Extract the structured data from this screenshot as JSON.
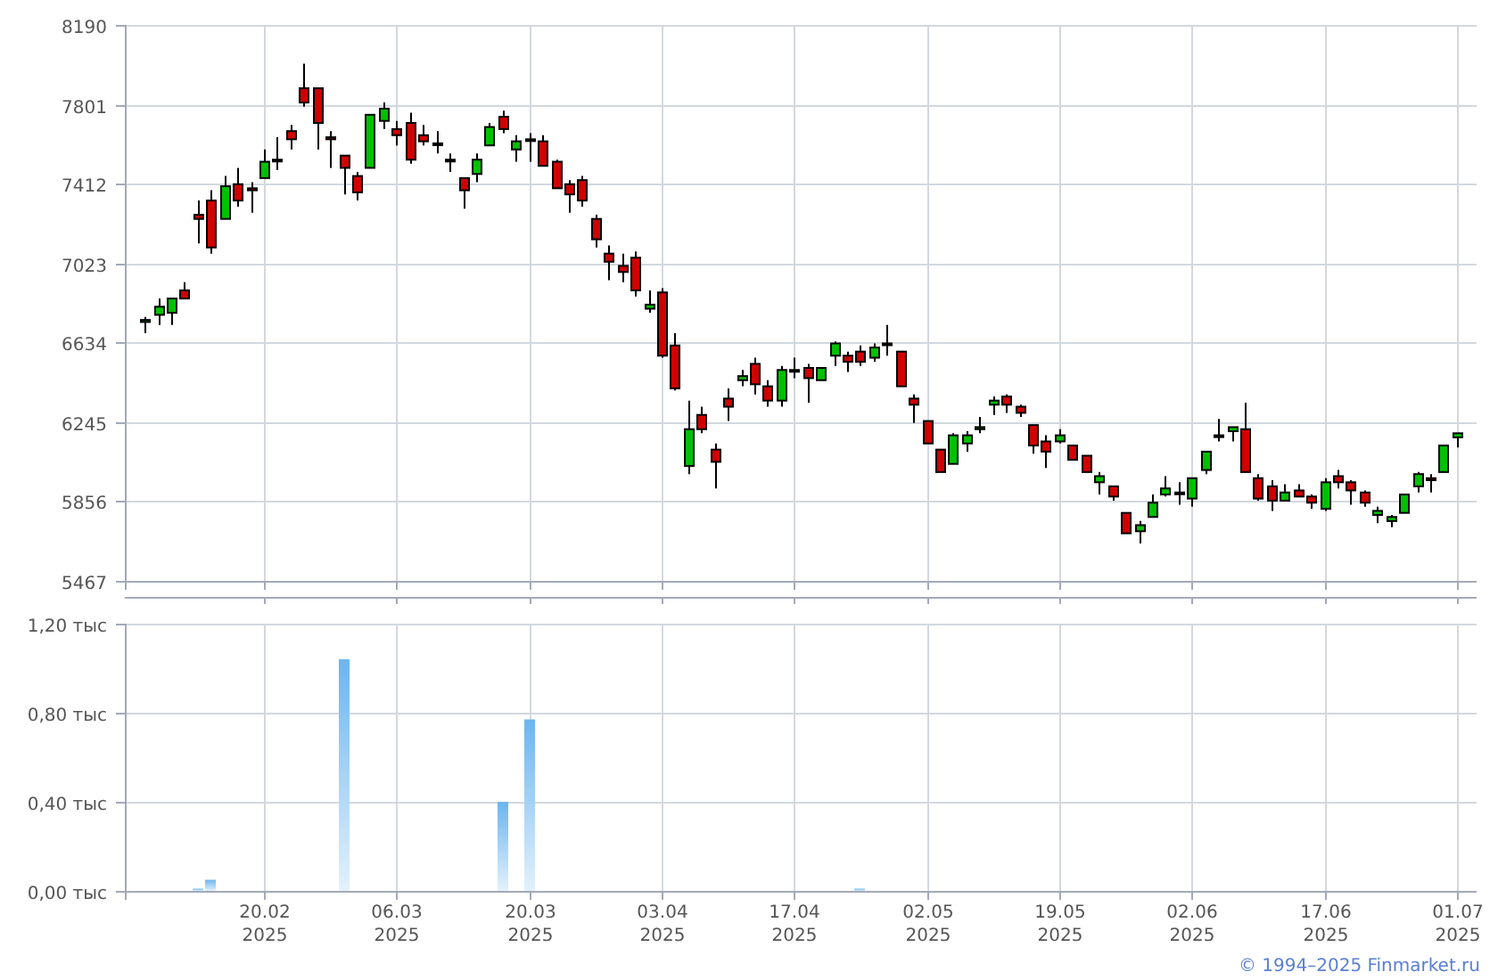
{
  "price_chart": {
    "chart_data": {
      "type": "candlestick",
      "grid": true,
      "ylim": [
        5467,
        8190
      ],
      "yticks": [
        8190,
        7801,
        7412,
        7023,
        6634,
        6245,
        5856,
        5467
      ],
      "categories": [
        null,
        null,
        null,
        null,
        null,
        null,
        null,
        null,
        null,
        null,
        null,
        null,
        null,
        null,
        null,
        null,
        null,
        null,
        null,
        null,
        null,
        null,
        null,
        null,
        null,
        null,
        null,
        null,
        null,
        null,
        null,
        null,
        null,
        null,
        null,
        null,
        null,
        null,
        null,
        null,
        null,
        null,
        null,
        null,
        null,
        null,
        null,
        null,
        null,
        null,
        null,
        null,
        null,
        null,
        null,
        null,
        null,
        null,
        null,
        null,
        null,
        null,
        null,
        null,
        null,
        null,
        null,
        null,
        null,
        null,
        null,
        null,
        null,
        null,
        null,
        null,
        null,
        null,
        null,
        null,
        null,
        null,
        null,
        null,
        null,
        null,
        null,
        null,
        null,
        null,
        null,
        null,
        null,
        null,
        null,
        null,
        null,
        null,
        null,
        null,
        null,
        null
      ],
      "ohlc": [
        null,
        [
          6735,
          6760,
          6680,
          6745
        ],
        [
          6770,
          6850,
          6720,
          6810
        ],
        [
          6780,
          6850,
          6720,
          6850
        ],
        [
          6890,
          6930,
          6850,
          6850
        ],
        [
          7260,
          7330,
          7120,
          7240
        ],
        [
          7330,
          7380,
          7070,
          7100
        ],
        [
          7240,
          7450,
          7240,
          7400
        ],
        [
          7410,
          7490,
          7300,
          7330
        ],
        [
          7390,
          7420,
          7270,
          7380
        ],
        [
          7440,
          7580,
          7440,
          7520
        ],
        [
          7530,
          7640,
          7480,
          7530
        ],
        [
          7670,
          7700,
          7580,
          7630
        ],
        [
          7880,
          8000,
          7790,
          7810
        ],
        [
          7880,
          7880,
          7580,
          7710
        ],
        [
          7640,
          7670,
          7490,
          7630
        ],
        [
          7550,
          7550,
          7360,
          7490
        ],
        [
          7450,
          7470,
          7330,
          7370
        ],
        [
          7490,
          7750,
          7490,
          7750
        ],
        [
          7720,
          7810,
          7680,
          7780
        ],
        [
          7680,
          7720,
          7600,
          7650
        ],
        [
          7710,
          7760,
          7510,
          7530
        ],
        [
          7650,
          7700,
          7600,
          7620
        ],
        [
          7610,
          7670,
          7560,
          7610
        ],
        [
          7530,
          7560,
          7470,
          7530
        ],
        [
          7440,
          7440,
          7290,
          7380
        ],
        [
          7460,
          7560,
          7420,
          7530
        ],
        [
          7600,
          7710,
          7600,
          7690
        ],
        [
          7740,
          7770,
          7660,
          7680
        ],
        [
          7580,
          7650,
          7520,
          7620
        ],
        [
          7630,
          7660,
          7520,
          7630
        ],
        [
          7620,
          7650,
          7500,
          7500
        ],
        [
          7520,
          7530,
          7390,
          7390
        ],
        [
          7410,
          7430,
          7270,
          7360
        ],
        [
          7430,
          7450,
          7300,
          7330
        ],
        [
          7240,
          7260,
          7100,
          7140
        ],
        [
          7070,
          7110,
          6940,
          7030
        ],
        [
          7010,
          7070,
          6930,
          6980
        ],
        [
          7050,
          7080,
          6860,
          6890
        ],
        [
          6800,
          6890,
          6780,
          6820
        ],
        [
          6880,
          6900,
          6560,
          6570
        ],
        [
          6620,
          6680,
          6400,
          6410
        ],
        [
          6030,
          6350,
          5990,
          6210
        ],
        [
          6280,
          6320,
          6190,
          6210
        ],
        [
          6110,
          6140,
          5920,
          6050
        ],
        [
          6360,
          6410,
          6250,
          6320
        ],
        [
          6450,
          6500,
          6420,
          6470
        ],
        [
          6530,
          6560,
          6380,
          6430
        ],
        [
          6420,
          6450,
          6320,
          6350
        ],
        [
          6350,
          6520,
          6320,
          6500
        ],
        [
          6500,
          6560,
          6460,
          6500
        ],
        [
          6510,
          6530,
          6340,
          6460
        ],
        [
          6450,
          6510,
          6450,
          6510
        ],
        [
          6570,
          6640,
          6520,
          6630
        ],
        [
          6570,
          6590,
          6490,
          6540
        ],
        [
          6590,
          6620,
          6520,
          6540
        ],
        [
          6560,
          6630,
          6540,
          6610
        ],
        [
          6630,
          6720,
          6570,
          6630
        ],
        [
          6590,
          6590,
          6420,
          6420
        ],
        [
          6360,
          6380,
          6240,
          6330
        ],
        [
          6250,
          6250,
          6140,
          6140
        ],
        [
          6110,
          6110,
          6000,
          6000
        ],
        [
          6040,
          6190,
          6040,
          6180
        ],
        [
          6140,
          6200,
          6100,
          6180
        ],
        [
          6210,
          6270,
          6190,
          6220
        ],
        [
          6330,
          6370,
          6280,
          6350
        ],
        [
          6370,
          6380,
          6290,
          6330
        ],
        [
          6320,
          6330,
          6270,
          6290
        ],
        [
          6230,
          6230,
          6090,
          6130
        ],
        [
          6150,
          6180,
          6020,
          6100
        ],
        [
          6150,
          6210,
          6140,
          6180
        ],
        [
          6130,
          6130,
          6060,
          6060
        ],
        [
          6080,
          6080,
          6000,
          6000
        ],
        [
          5950,
          6000,
          5890,
          5980
        ],
        [
          5930,
          5930,
          5860,
          5880
        ],
        [
          5800,
          5800,
          5700,
          5700
        ],
        [
          5710,
          5760,
          5650,
          5740
        ],
        [
          5780,
          5890,
          5780,
          5850
        ],
        [
          5890,
          5980,
          5880,
          5920
        ],
        [
          5900,
          5950,
          5840,
          5900
        ],
        [
          5870,
          5970,
          5830,
          5970
        ],
        [
          6010,
          6100,
          5990,
          6100
        ],
        [
          6180,
          6260,
          6150,
          6180
        ],
        [
          6200,
          6220,
          6150,
          6220
        ],
        [
          6210,
          6340,
          6000,
          6000
        ],
        [
          5970,
          5990,
          5860,
          5870
        ],
        [
          5930,
          5960,
          5810,
          5860
        ],
        [
          5860,
          5940,
          5860,
          5900
        ],
        [
          5910,
          5940,
          5880,
          5880
        ],
        [
          5880,
          5890,
          5820,
          5850
        ],
        [
          5820,
          5970,
          5810,
          5950
        ],
        [
          5980,
          6010,
          5920,
          5950
        ],
        [
          5950,
          5960,
          5840,
          5910
        ],
        [
          5900,
          5910,
          5830,
          5850
        ],
        [
          5790,
          5830,
          5750,
          5810
        ],
        [
          5760,
          5790,
          5730,
          5780
        ],
        [
          5800,
          5890,
          5800,
          5890
        ],
        [
          5930,
          6000,
          5900,
          5990
        ],
        [
          5970,
          5990,
          5900,
          5960
        ],
        [
          6000,
          6130,
          6000,
          6130
        ],
        [
          6170,
          6190,
          6120,
          6190
        ],
        null
      ]
    }
  },
  "volume_chart": {
    "chart_data": {
      "type": "bar",
      "grid": true,
      "ylim": [
        0,
        1.2
      ],
      "yticks": [
        {
          "value": 0,
          "label": "0,00 тыс"
        },
        {
          "value": 0.4,
          "label": "0,40 тыс"
        },
        {
          "value": 0.8,
          "label": "0,80 тыс"
        },
        {
          "value": 1.2,
          "label": "1,20 тыс"
        }
      ],
      "categories": [
        null,
        null,
        null,
        null,
        null,
        null,
        null,
        null,
        null,
        null,
        "20.02\n2025",
        null,
        null,
        null,
        null,
        null,
        null,
        null,
        null,
        null,
        "06.03\n2025",
        null,
        null,
        null,
        null,
        null,
        null,
        null,
        null,
        null,
        "20.03\n2025",
        null,
        null,
        null,
        null,
        null,
        null,
        null,
        null,
        null,
        "03.04\n2025",
        null,
        null,
        null,
        null,
        null,
        null,
        null,
        null,
        null,
        "17.04\n2025",
        null,
        null,
        null,
        null,
        null,
        null,
        null,
        null,
        null,
        "02.05\n2025",
        null,
        null,
        null,
        null,
        null,
        null,
        null,
        null,
        null,
        "19.05\n2025",
        null,
        null,
        null,
        null,
        null,
        null,
        null,
        null,
        null,
        "02.06\n2025",
        null,
        null,
        null,
        null,
        null,
        null,
        null,
        null,
        null,
        "17.06\n2025",
        null,
        null,
        null,
        null,
        null,
        null,
        null,
        null,
        null,
        "01.07\n2025",
        null
      ],
      "values": [
        null,
        null,
        null,
        null,
        null,
        0.01,
        0.05,
        null,
        null,
        null,
        null,
        null,
        null,
        null,
        null,
        null,
        1.04,
        null,
        null,
        null,
        null,
        null,
        null,
        null,
        null,
        null,
        null,
        null,
        0.4,
        null,
        0.77,
        null,
        null,
        null,
        null,
        null,
        null,
        null,
        null,
        null,
        null,
        null,
        null,
        null,
        null,
        null,
        null,
        null,
        null,
        null,
        null,
        null,
        null,
        null,
        null,
        0.01,
        null,
        null,
        null,
        null,
        null,
        null,
        null,
        null,
        null,
        null,
        null,
        null,
        null,
        null,
        null,
        null,
        null,
        null,
        null,
        null,
        null,
        null,
        null,
        null,
        null,
        null,
        null,
        null,
        null,
        null,
        null,
        null,
        null,
        null,
        null,
        null,
        null,
        null,
        null,
        null,
        null,
        null,
        null,
        null,
        null,
        null
      ]
    }
  },
  "footer": {
    "copyright": "© 1994–2025 Finmarket.ru"
  }
}
